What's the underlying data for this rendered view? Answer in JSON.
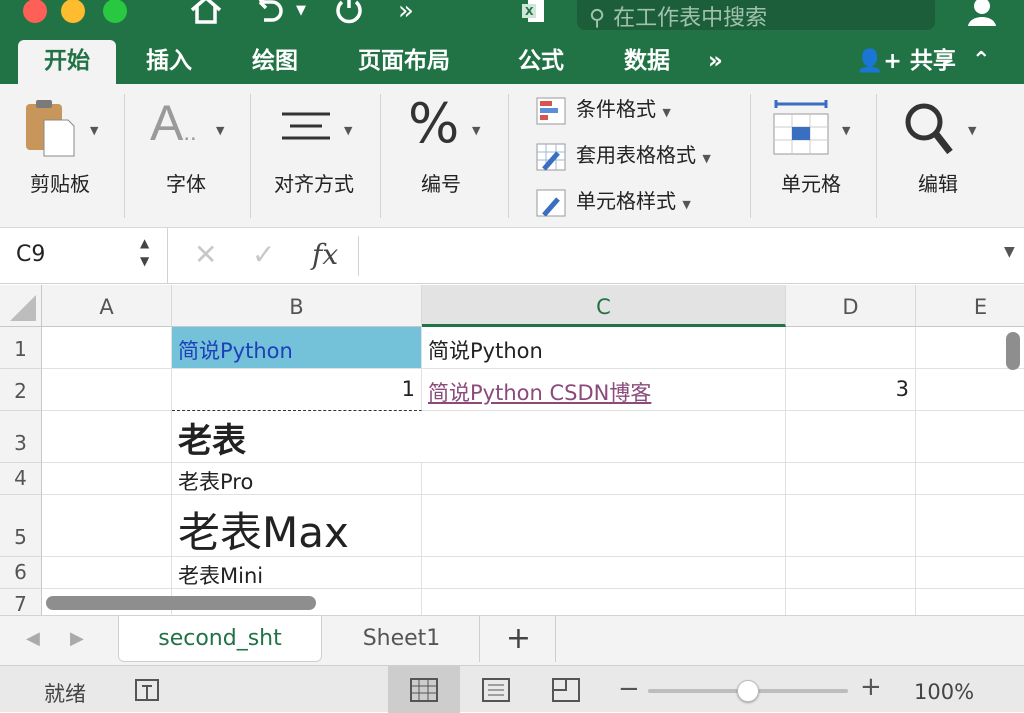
{
  "titlebar": {
    "search_placeholder": "在工作表中搜索",
    "colors": {
      "app_green": "#217346"
    }
  },
  "ribbon_tabs": [
    {
      "label": "开始",
      "active": true
    },
    {
      "label": "插入"
    },
    {
      "label": "绘图"
    },
    {
      "label": "页面布局"
    },
    {
      "label": "公式"
    },
    {
      "label": "数据"
    },
    {
      "label": "»"
    }
  ],
  "share": {
    "label": "共享"
  },
  "ribbon": {
    "clipboard": "剪贴板",
    "font": "字体",
    "alignment": "对齐方式",
    "number": "编号",
    "conditional_format": "条件格式",
    "table_format": "套用表格格式",
    "cell_styles": "单元格样式",
    "cells": "单元格",
    "editing": "编辑"
  },
  "formula_bar": {
    "name_box": "C9",
    "formula": ""
  },
  "columns": [
    "A",
    "B",
    "C",
    "D",
    "E"
  ],
  "selected_column": "C",
  "rows": [
    "1",
    "2",
    "3",
    "4",
    "5",
    "6",
    "7"
  ],
  "cells": {
    "B1": "简说Python",
    "C1": "简说Python",
    "B2": "1",
    "C2": "简说Python CSDN博客",
    "D2": "3",
    "B3": "老表",
    "B4": "老表Pro",
    "B5": "老表Max",
    "B6": "老表Mini"
  },
  "sheets": [
    {
      "name": "second_sht",
      "active": true
    },
    {
      "name": "Sheet1",
      "active": false
    }
  ],
  "add_sheet": "+",
  "status": {
    "ready": "就绪",
    "zoom": "100%",
    "zoom_value_percent": 100
  }
}
